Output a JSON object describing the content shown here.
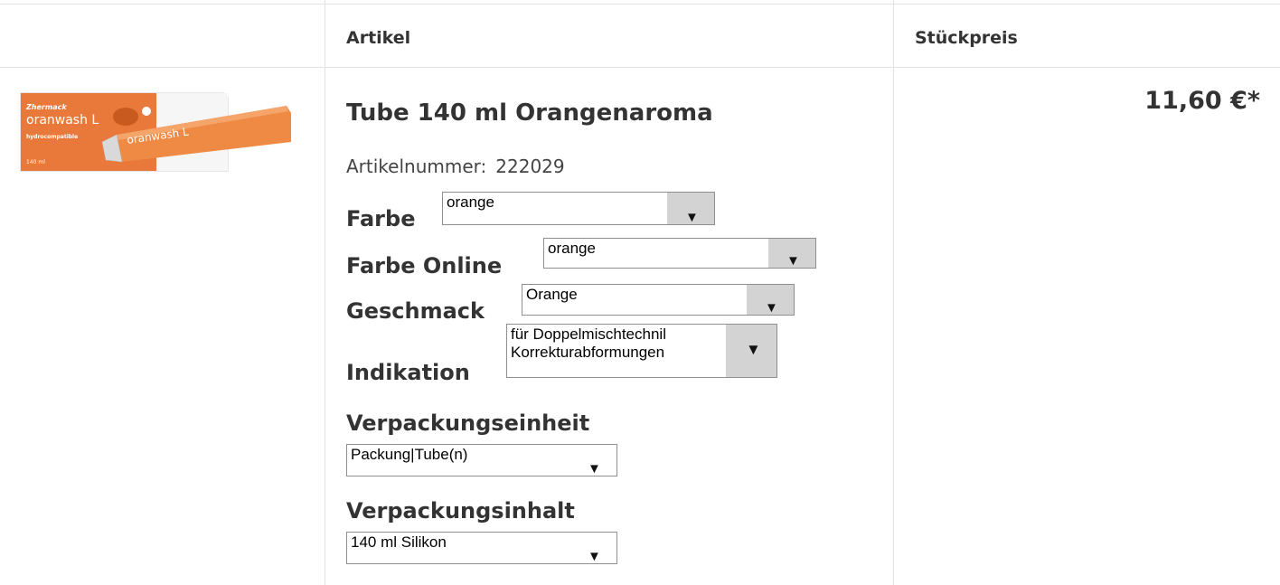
{
  "table": {
    "headers": {
      "article": "Artikel",
      "unit_price": "Stückpreis"
    }
  },
  "product": {
    "image_alt": "Zhermack oranwash L",
    "brand": "Zhermack",
    "image_name": "oranwash L",
    "image_subtext": "hydrocompatible",
    "image_volume": "140 ml",
    "title": "Tube 140 ml Orangenaroma",
    "article_number_label": "Artikelnummer:",
    "article_number": "222029",
    "price": "11,60 €*"
  },
  "options": {
    "farbe": {
      "label": "Farbe",
      "value": "orange"
    },
    "farbe_online": {
      "label": "Farbe Online",
      "value": "orange"
    },
    "geschmack": {
      "label": "Geschmack",
      "value": "Orange"
    },
    "indikation": {
      "label": "Indikation",
      "value_line1": "für Doppelmischtechnil",
      "value_line2": "Korrekturabformungen"
    },
    "verpackungseinheit": {
      "label": "Verpackungseinheit",
      "value": "Packung|Tube(n)"
    },
    "verpackungsinhalt": {
      "label": "Verpackungsinhalt",
      "value": "140 ml Silikon"
    }
  },
  "icons": {
    "dropdown": "triangle-down-icon",
    "dropdown_glyph": "▼"
  },
  "colors": {
    "product_orange": "#e8793a",
    "border": "#e2e2e2",
    "select_arrow_bg": "#d3d3d3"
  }
}
